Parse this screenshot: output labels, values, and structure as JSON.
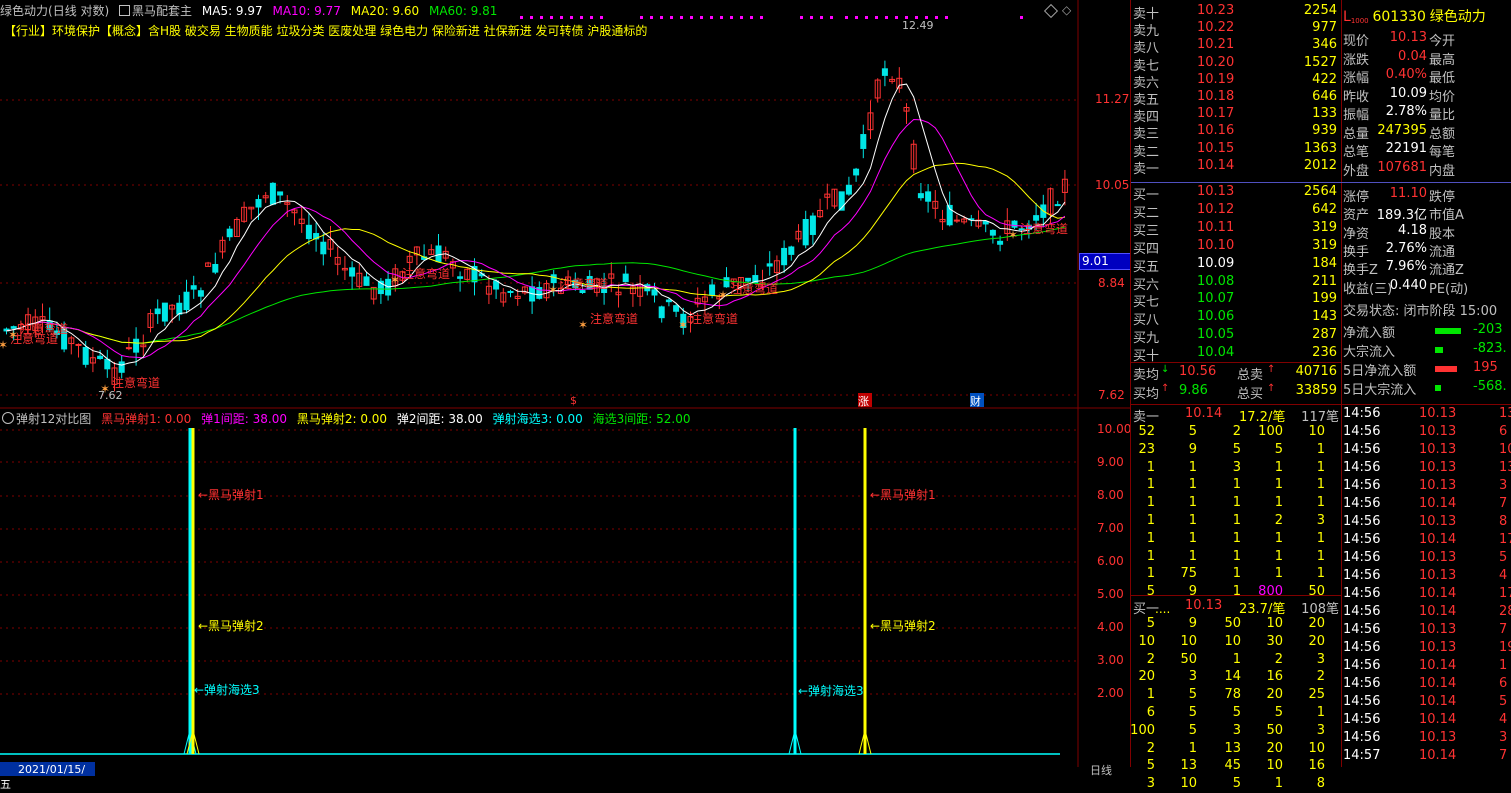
{
  "header": {
    "stock_name": "绿色动力",
    "period": "(日线 对数)",
    "indicator": "黑马配套主",
    "ma5": "MA5: 9.97",
    "ma10": "MA10: 9.77",
    "ma20": "MA20: 9.60",
    "ma60": "MA60: 9.81",
    "concept": "【行业】环境保护【概念】含H股 破交易 生物质能 垃圾分类 医废处理 绿色电力 保险新进 社保新进 发可转债 沪股通标的"
  },
  "main_axis": {
    "ticks": [
      "11.27",
      "10.05",
      "8.84",
      "7.62"
    ],
    "current_price": "9.01",
    "high_label": "12.49",
    "low_label": "7.62"
  },
  "annotations": [
    "注意弯道",
    "注意弯道",
    "注意弯道",
    "注意弯道",
    "注意弯道",
    "注意弯道",
    "注意弯道",
    "注意弯道",
    "注意弯道"
  ],
  "markers": [
    "$",
    "涨",
    "财"
  ],
  "sub": {
    "title": "弹射12对比图",
    "l1": "黑马弹射1: 0.00",
    "l2": "弹1间距: 38.00",
    "l3": "黑马弹射2: 0.00",
    "l4": "弹2间距: 38.00",
    "l5": "弹射海选3: 0.00",
    "l6": "海选3间距: 52.00",
    "ticks": [
      "10.00",
      "9.00",
      "8.00",
      "7.00",
      "6.00",
      "5.00",
      "4.00",
      "3.00",
      "2.00"
    ],
    "lab_a": "←黑马弹射1",
    "lab_b": "←黑马弹射2",
    "lab_c": "←弹射海选3",
    "lab_d": "←弹射海选3",
    "lab_e": "←黑马弹射1",
    "lab_f": "←黑马弹射2",
    "date": "2021/01/15/五",
    "period_tab": "日线"
  },
  "orderbook": {
    "asks": [
      {
        "label": "卖十",
        "price": "10.23",
        "vol": "2254"
      },
      {
        "label": "卖九",
        "price": "10.22",
        "vol": "977"
      },
      {
        "label": "卖八",
        "price": "10.21",
        "vol": "346"
      },
      {
        "label": "卖七",
        "price": "10.20",
        "vol": "1527"
      },
      {
        "label": "卖六",
        "price": "10.19",
        "vol": "422"
      },
      {
        "label": "卖五",
        "price": "10.18",
        "vol": "646"
      },
      {
        "label": "卖四",
        "price": "10.17",
        "vol": "133"
      },
      {
        "label": "卖三",
        "price": "10.16",
        "vol": "939"
      },
      {
        "label": "卖二",
        "price": "10.15",
        "vol": "1363"
      },
      {
        "label": "卖一",
        "price": "10.14",
        "vol": "2012"
      }
    ],
    "bids": [
      {
        "label": "买一",
        "price": "10.13",
        "vol": "2564"
      },
      {
        "label": "买二",
        "price": "10.12",
        "vol": "642"
      },
      {
        "label": "买三",
        "price": "10.11",
        "vol": "319"
      },
      {
        "label": "买四",
        "price": "10.10",
        "vol": "319"
      },
      {
        "label": "买五",
        "price": "10.09",
        "vol": "184"
      },
      {
        "label": "买六",
        "price": "10.08",
        "vol": "211"
      },
      {
        "label": "买七",
        "price": "10.07",
        "vol": "199"
      },
      {
        "label": "买八",
        "price": "10.06",
        "vol": "143"
      },
      {
        "label": "买九",
        "price": "10.05",
        "vol": "287"
      },
      {
        "label": "买十",
        "price": "10.04",
        "vol": "236"
      }
    ],
    "avg_sell_label": "卖均",
    "avg_sell": "10.56",
    "total_sell_label": "总卖",
    "total_sell": "40716",
    "avg_buy_label": "买均",
    "avg_buy": "9.86",
    "total_buy_label": "总买",
    "total_buy": "33859"
  },
  "quote": {
    "code": "601330",
    "name": "绿色动力",
    "rows": [
      {
        "k1": "现价",
        "v1": "10.13",
        "k2": "今开"
      },
      {
        "k1": "涨跌",
        "v1": "0.04",
        "k2": "最高"
      },
      {
        "k1": "涨幅",
        "v1": "0.40%",
        "k2": "最低"
      },
      {
        "k1": "昨收",
        "v1": "10.09",
        "k2": "均价"
      },
      {
        "k1": "振幅",
        "v1": "2.78%",
        "k2": "量比"
      },
      {
        "k1": "总量",
        "v1": "247395",
        "k2": "总额"
      },
      {
        "k1": "总笔",
        "v1": "22191",
        "k2": "每笔"
      },
      {
        "k1": "外盘",
        "v1": "107681",
        "k2": "内盘"
      },
      {
        "k1": "涨停",
        "v1": "11.10",
        "k2": "跌停"
      },
      {
        "k1": "资产",
        "v1": "189.3亿",
        "k2": "市值A"
      },
      {
        "k1": "净资",
        "v1": "4.18",
        "k2": "股本"
      },
      {
        "k1": "换手",
        "v1": "2.76%",
        "k2": "流通"
      },
      {
        "k1": "换手Z",
        "v1": "7.96%",
        "k2": "流通Z"
      },
      {
        "k1": "收益(三)",
        "v1": "0.440",
        "k2": "PE(动)"
      }
    ],
    "trade_status": "交易状态: 闭市阶段 15:00",
    "flows": [
      {
        "label": "净流入额",
        "value": "-203"
      },
      {
        "label": "大宗流入",
        "value": "-823."
      },
      {
        "label": "5日净流入额",
        "value": "195"
      },
      {
        "label": "5日大宗流入",
        "value": "-568."
      }
    ]
  },
  "queue1": {
    "head": "卖一",
    "price": "10.14",
    "per": "17.2/笔",
    "count": "117笔",
    "rows": [
      [
        "52",
        "5",
        "2",
        "100",
        "10"
      ],
      [
        "23",
        "9",
        "5",
        "5",
        "1"
      ],
      [
        "1",
        "1",
        "3",
        "1",
        "1"
      ],
      [
        "1",
        "1",
        "1",
        "1",
        "1"
      ],
      [
        "1",
        "1",
        "1",
        "1",
        "1"
      ],
      [
        "1",
        "1",
        "1",
        "2",
        "3"
      ],
      [
        "1",
        "1",
        "1",
        "1",
        "1"
      ],
      [
        "1",
        "1",
        "1",
        "1",
        "1"
      ],
      [
        "1",
        "75",
        "1",
        "1",
        "1"
      ],
      [
        "5",
        "9",
        "1",
        "800",
        "50"
      ]
    ],
    "more": "...."
  },
  "queue2": {
    "head": "买一",
    "price": "10.13",
    "per": "23.7/笔",
    "count": "108笔",
    "rows": [
      [
        "5",
        "9",
        "50",
        "10",
        "20"
      ],
      [
        "10",
        "10",
        "10",
        "30",
        "20"
      ],
      [
        "2",
        "50",
        "1",
        "2",
        "3"
      ],
      [
        "20",
        "3",
        "14",
        "16",
        "2"
      ],
      [
        "1",
        "5",
        "78",
        "20",
        "25"
      ],
      [
        "6",
        "5",
        "5",
        "5",
        "1"
      ],
      [
        "100",
        "5",
        "3",
        "50",
        "3"
      ],
      [
        "2",
        "1",
        "13",
        "20",
        "10"
      ],
      [
        "5",
        "13",
        "45",
        "10",
        "16"
      ],
      [
        "3",
        "10",
        "5",
        "1",
        "8"
      ]
    ]
  },
  "ticks": [
    {
      "t": "14:56",
      "p": "10.13",
      "v": "13",
      "c": "red"
    },
    {
      "t": "14:56",
      "p": "10.13",
      "v": "6",
      "c": "red"
    },
    {
      "t": "14:56",
      "p": "10.13",
      "v": "10",
      "c": "red"
    },
    {
      "t": "14:56",
      "p": "10.13",
      "v": "13",
      "c": "red"
    },
    {
      "t": "14:56",
      "p": "10.13",
      "v": "3",
      "c": "red"
    },
    {
      "t": "14:56",
      "p": "10.14",
      "v": "7",
      "c": "red"
    },
    {
      "t": "14:56",
      "p": "10.13",
      "v": "8",
      "c": "red"
    },
    {
      "t": "14:56",
      "p": "10.14",
      "v": "17",
      "c": "red"
    },
    {
      "t": "14:56",
      "p": "10.13",
      "v": "5",
      "c": "red"
    },
    {
      "t": "14:56",
      "p": "10.13",
      "v": "4",
      "c": "red"
    },
    {
      "t": "14:56",
      "p": "10.14",
      "v": "17",
      "c": "red"
    },
    {
      "t": "14:56",
      "p": "10.14",
      "v": "28",
      "c": "red"
    },
    {
      "t": "14:56",
      "p": "10.13",
      "v": "7",
      "c": "red"
    },
    {
      "t": "14:56",
      "p": "10.13",
      "v": "19",
      "c": "red"
    },
    {
      "t": "14:56",
      "p": "10.14",
      "v": "1",
      "c": "red"
    },
    {
      "t": "14:56",
      "p": "10.14",
      "v": "6",
      "c": "red"
    },
    {
      "t": "14:56",
      "p": "10.14",
      "v": "5",
      "c": "red"
    },
    {
      "t": "14:56",
      "p": "10.14",
      "v": "4",
      "c": "red"
    },
    {
      "t": "14:56",
      "p": "10.13",
      "v": "3",
      "c": "red"
    },
    {
      "t": "14:57",
      "p": "10.14",
      "v": "7",
      "c": "red"
    }
  ],
  "colors": {
    "up": "#ff3232",
    "down": "#00e6e6",
    "ma5": "#ffffff",
    "ma10": "#ff00ff",
    "ma20": "#ffff00",
    "ma60": "#00e600",
    "grid": "#800000"
  }
}
